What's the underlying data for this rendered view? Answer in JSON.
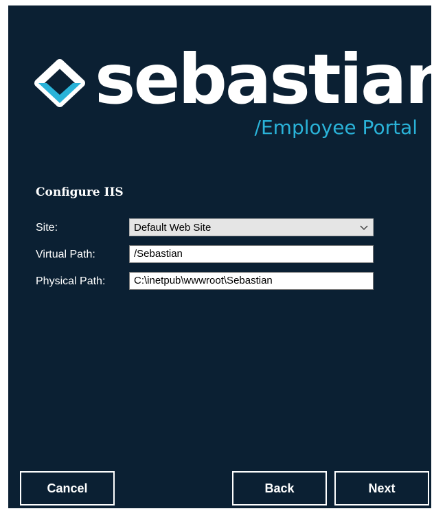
{
  "logo": {
    "icon": "sebastian-diamond-logo-icon",
    "brand": "sebastian",
    "tagline": "/Employee Portal"
  },
  "colors": {
    "background": "#0b2033",
    "accent": "#2ab3d9",
    "text": "#ffffff"
  },
  "form": {
    "title": "Configure IIS",
    "site_label": "Site:",
    "site_value": "Default Web Site",
    "virtual_path_label": "Virtual Path:",
    "virtual_path_value": "/Sebastian",
    "physical_path_label": "Physical Path:",
    "physical_path_value": "C:\\inetpub\\wwwroot\\Sebastian"
  },
  "buttons": {
    "cancel": "Cancel",
    "back": "Back",
    "next": "Next"
  }
}
